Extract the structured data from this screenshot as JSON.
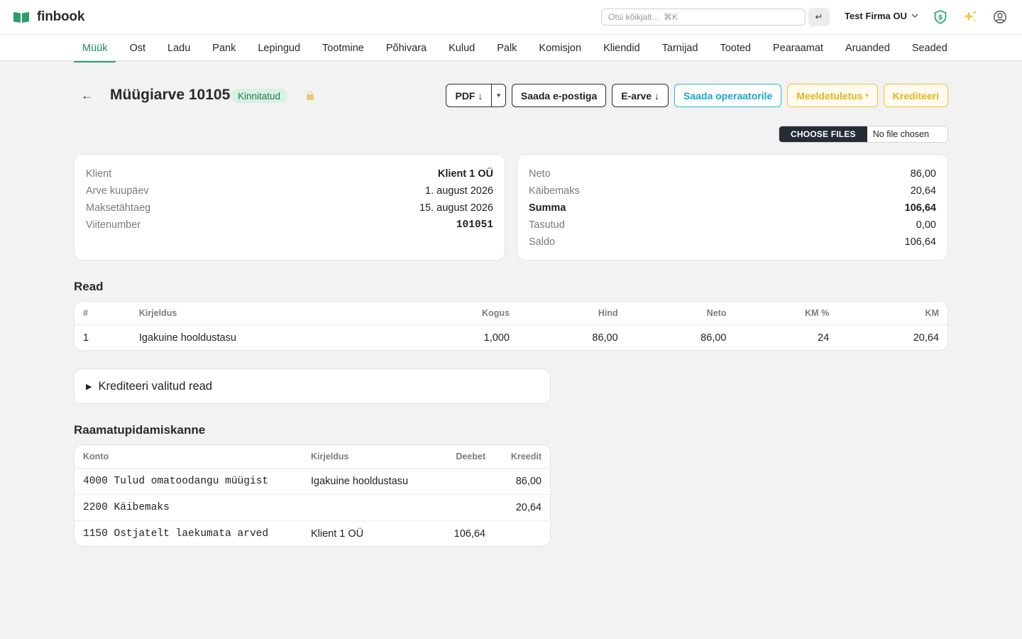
{
  "app": {
    "logo_text": "finbook",
    "search_placeholder": "Otsi kõikjalt...  ⌘K",
    "enter_key": "↵",
    "company": "Test Firma OU",
    "colors": {
      "brand_green": "#2a9d6a",
      "accent_cyan": "#14a8cc",
      "accent_yellow": "#e3b419",
      "badge_bg": "#d9f0e3"
    }
  },
  "nav": {
    "items": [
      "Müük",
      "Ost",
      "Ladu",
      "Pank",
      "Lepingud",
      "Tootmine",
      "Põhivara",
      "Kulud",
      "Palk",
      "Komisjon",
      "Kliendid",
      "Tarnijad",
      "Tooted",
      "Pearaamat",
      "Aruanded",
      "Seaded"
    ],
    "active": "Müük"
  },
  "invoice": {
    "back_arrow": "←",
    "title": "Müügiarve 10105",
    "status": "Kinnitatud",
    "actions": {
      "pdf": "PDF ↓",
      "pdf_caret": "▾",
      "email": "Saada e-postiga",
      "einvoice": "E-arve ↓",
      "operator": "Saada operaatorile",
      "reminder": "Meeldetuletus",
      "reminder_caret": "▾",
      "credit": "Krediteeri"
    },
    "file": {
      "choose": "CHOOSE FILES",
      "none": "No file chosen"
    }
  },
  "details": {
    "client_label": "Klient",
    "client_value": "Klient 1 OÜ",
    "date_label": "Arve kuupäev",
    "date_value": "1. august 2026",
    "due_label": "Maksetähtaeg",
    "due_value": "15. august 2026",
    "ref_label": "Viitenumber",
    "ref_value": "101051"
  },
  "totals": {
    "net_label": "Neto",
    "net_value": "86,00",
    "vat_label": "Käibemaks",
    "vat_value": "20,64",
    "sum_label": "Summa",
    "sum_value": "106,64",
    "paid_label": "Tasutud",
    "paid_value": "0,00",
    "balance_label": "Saldo",
    "balance_value": "106,64"
  },
  "rows": {
    "title": "Read",
    "headers": {
      "num": "#",
      "desc": "Kirjeldus",
      "qty": "Kogus",
      "price": "Hind",
      "net": "Neto",
      "vatpct": "KM %",
      "vat": "KM"
    },
    "items": [
      {
        "num": "1",
        "desc": "Igakuine hooldustasu",
        "qty": "1,000",
        "price": "86,00",
        "net": "86,00",
        "vatpct": "24",
        "vat": "20,64"
      }
    ]
  },
  "credit_rows": {
    "label": "Krediteeri valitud read",
    "marker": "▶"
  },
  "journal": {
    "title": "Raamatupidamiskanne",
    "headers": {
      "account": "Konto",
      "desc": "Kirjeldus",
      "debit": "Deebet",
      "credit": "Kreedit"
    },
    "entries": [
      {
        "account": "4000 Tulud omatoodangu müügist",
        "desc": "Igakuine hooldustasu",
        "debit": "",
        "credit": "86,00"
      },
      {
        "account": "2200 Käibemaks",
        "desc": "",
        "debit": "",
        "credit": "20,64"
      },
      {
        "account": "1150 Ostjatelt laekumata arved",
        "desc": "Klient 1 OÜ",
        "debit": "106,64",
        "credit": ""
      }
    ]
  }
}
